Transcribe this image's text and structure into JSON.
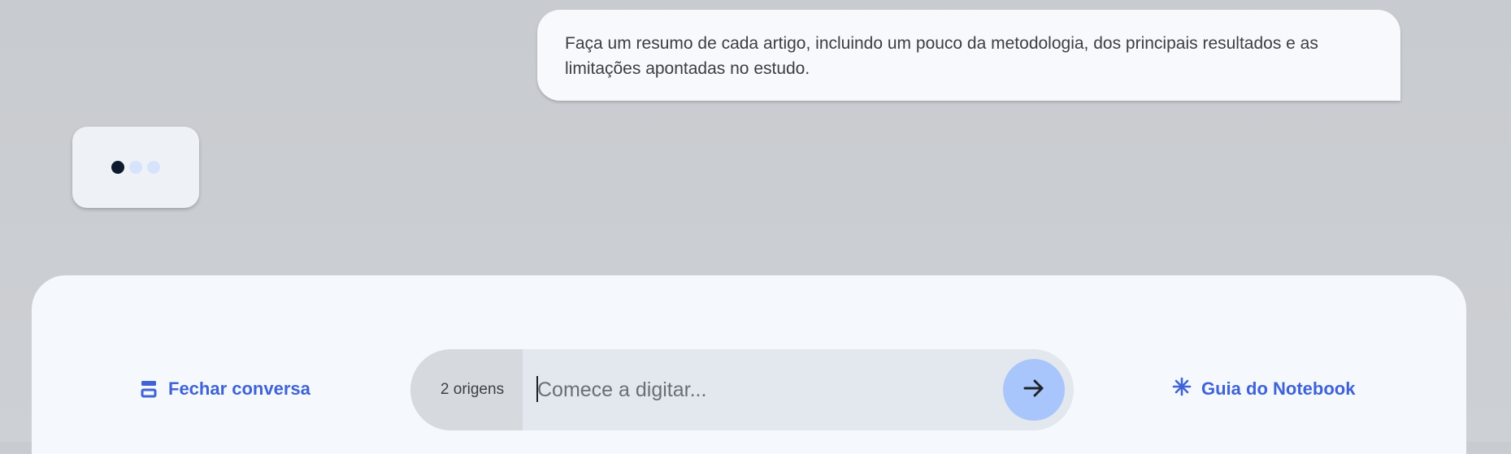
{
  "conversation": {
    "user_message": "Faça um resumo de cada artigo, incluindo um pouco da metodologia, dos principais resultados e as limitações apontadas no estudo.",
    "loading_indicator": {
      "dots": 3,
      "active_dot": 1
    }
  },
  "composer": {
    "close_chat_label": "Fechar conversa",
    "close_chat_icon": "collapse-chat-icon",
    "sources_label": "2 origens",
    "input_placeholder": "Comece a digitar...",
    "input_value": "",
    "send_icon": "arrow-right-icon",
    "guide_label": "Guia do Notebook",
    "guide_icon": "asterisk-sparkle-icon"
  },
  "colors": {
    "background": "#c9ccd0",
    "panel": "#f5f8fd",
    "accent": "#3f63d6",
    "send_button": "#a8c6fb",
    "loading_dot_active": "#0e1b2e",
    "loading_dot_inactive": "#d6e3fb"
  }
}
